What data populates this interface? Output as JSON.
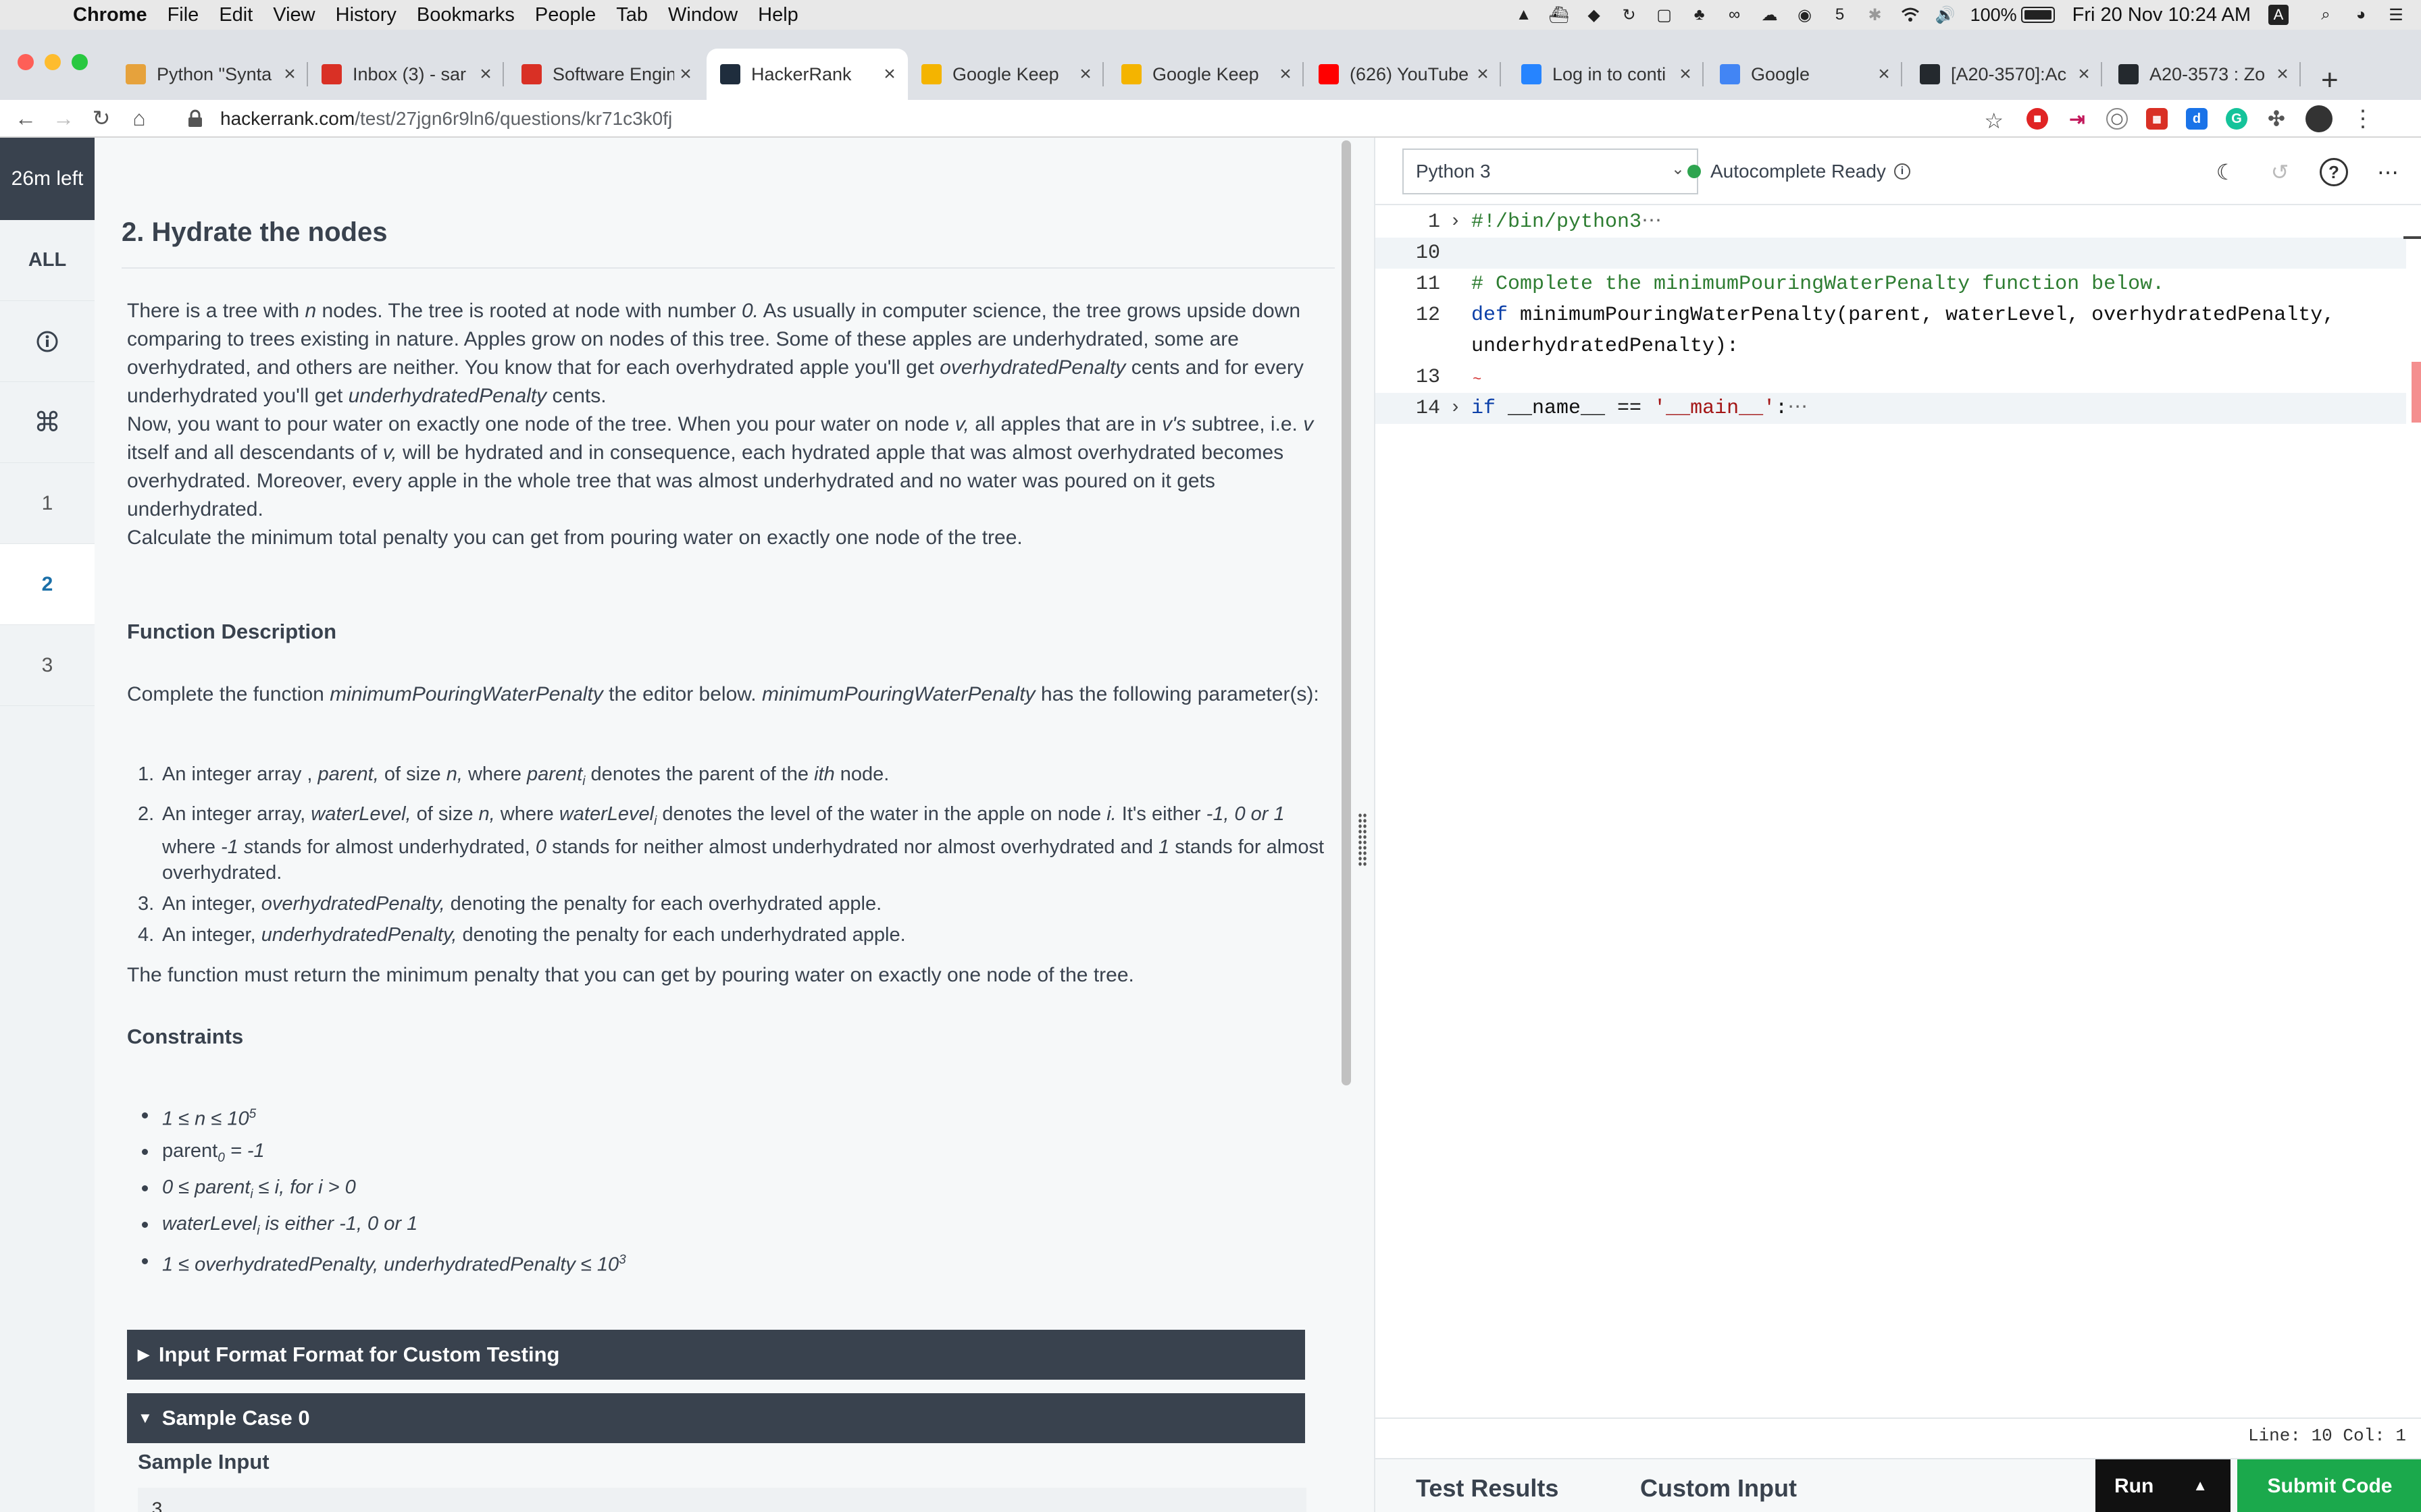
{
  "menubar": {
    "items": [
      "Chrome",
      "File",
      "Edit",
      "View",
      "History",
      "Bookmarks",
      "People",
      "Tab",
      "Window",
      "Help"
    ],
    "battery": "100%",
    "clock": "Fri 20 Nov  10:24 AM",
    "keyboard": "A"
  },
  "tabs": [
    {
      "title": "Python \"Synta",
      "icon": "python-doc-icon",
      "color": "#e6a23c"
    },
    {
      "title": "Inbox (3) - sar",
      "icon": "gmail-icon",
      "color": "#d93025"
    },
    {
      "title": "Software Engin",
      "icon": "gmail-icon",
      "color": "#d93025"
    },
    {
      "title": "HackerRank",
      "icon": "hackerrank-icon",
      "color": "#1f2d3d"
    },
    {
      "title": "Google Keep",
      "icon": "keep-icon",
      "color": "#f4b400"
    },
    {
      "title": "Google Keep",
      "icon": "keep-icon",
      "color": "#f4b400"
    },
    {
      "title": "(626) YouTube",
      "icon": "youtube-icon",
      "color": "#ff0000"
    },
    {
      "title": "Log in to conti",
      "icon": "atlassian-icon",
      "color": "#2684ff"
    },
    {
      "title": "Google",
      "icon": "google-icon",
      "color": "#4285f4"
    },
    {
      "title": "[A20-3570]:Ac",
      "icon": "github-icon",
      "color": "#24292e"
    },
    {
      "title": "A20-3573 : Zo",
      "icon": "github-icon",
      "color": "#24292e"
    }
  ],
  "omnibox": {
    "host": "hackerrank.com",
    "path": "/test/27jgn6r9ln6/questions/kr71c3k0fj"
  },
  "rail": {
    "timer": "26m left",
    "all": "ALL",
    "questions": [
      "1",
      "2",
      "3"
    ]
  },
  "problem": {
    "title": "2. Hydrate the nodes",
    "p1": [
      "There is a tree with ",
      "n",
      " nodes. The tree is rooted at node with number ",
      "0.",
      " As usually in computer science, the tree grows upside down comparing to trees existing in nature. Apples grow on nodes of this tree. Some of these apples are underhydrated, some are overhydrated, and others are neither. You know that for each overhydrated apple you'll get ",
      "overhydratedPenalty",
      " cents and for every underhydrated you'll get ",
      "underhydratedPenalty",
      " cents."
    ],
    "p2": [
      "Now, you want to pour water on exactly one node of the tree. When you pour water on node ",
      "v,",
      " all apples that are in ",
      "v's",
      " subtree, i.e. ",
      "v",
      " itself and all descendants of ",
      "v,",
      " will be hydrated and in consequence, each hydrated apple that was almost overhydrated becomes overhydrated. Moreover, every apple in the whole tree that was almost underhydrated and no water was poured on it gets underhydrated."
    ],
    "p3": "Calculate the minimum total penalty you can get from pouring water on exactly one node of the tree.",
    "fd_heading": "Function Description",
    "fd_text": [
      "Complete the function ",
      "minimumPouringWaterPenalty",
      " the editor below. ",
      "minimumPouringWaterPenalty",
      " has the following parameter(s):"
    ],
    "params": [
      [
        "An integer array , ",
        "parent,",
        " of size ",
        "n,",
        " where ",
        "parent",
        "i",
        " denotes the parent of the ",
        "ith",
        " node."
      ],
      [
        "An integer array, ",
        "waterLevel,",
        " of size ",
        "n,",
        " where ",
        "waterLevel",
        "i",
        " denotes the level of the water in the apple on node ",
        "i.",
        " It's either ",
        "-1, 0 or 1",
        " where ",
        "-1 s",
        "tands for almost underhydrated, ",
        "0",
        " stands for neither almost underhydrated nor almost overhydrated and ",
        "1",
        " stands for almost overhydrated."
      ],
      [
        "An integer, ",
        "overhydratedPenalty,",
        " denoting the penalty for each overhydrated apple."
      ],
      [
        "An integer,  ",
        "underhydratedPenalty,",
        " denoting the penalty for each underhydrated apple."
      ]
    ],
    "return_text": "The function must return the minimum penalty that you can get by pouring water on exactly one node of the tree.",
    "constraints_heading": "Constraints",
    "constraints": [
      [
        "1 ≤ n ≤ 10",
        "5",
        ""
      ],
      [
        "parent",
        "0",
        " = -1"
      ],
      [
        "0 ≤ parent",
        "i",
        " ≤ i, for i > 0"
      ],
      [
        "waterLevel",
        "i",
        " is either -1, 0 or 1"
      ],
      [
        "1 ≤ overhydratedPenalty, underhydratedPenalty ≤ 10",
        "3",
        ""
      ]
    ],
    "accordion_input": "Input Format Format for Custom Testing",
    "accordion_sample": "Sample Case 0",
    "sample_input_label": "Sample Input",
    "sample_input_first": "3"
  },
  "editor": {
    "language": "Python 3",
    "autocomplete": "Autocomplete Ready",
    "lines": [
      {
        "n": "1",
        "fold": true,
        "tokens": [
          {
            "t": "#!/bin/python3",
            "c": "c-com"
          },
          {
            "t": "⋯",
            "c": "c-dots"
          }
        ]
      },
      {
        "n": "10",
        "hl": true,
        "tokens": []
      },
      {
        "n": "11",
        "tokens": [
          {
            "t": "# Complete the minimumPouringWaterPenalty function below.",
            "c": "c-com"
          }
        ]
      },
      {
        "n": "12",
        "tokens": [
          {
            "t": "def",
            "c": "c-kw"
          },
          {
            "t": " minimumPouringWaterPenalty(parent, waterLevel, overhydratedPenalty,",
            "c": ""
          }
        ]
      },
      {
        "n": "",
        "tokens": [
          {
            "t": "underhydratedPenalty):",
            "c": ""
          }
        ]
      },
      {
        "n": "13",
        "squiggle": true,
        "tokens": []
      },
      {
        "n": "14",
        "fold": true,
        "hl": true,
        "tokens": [
          {
            "t": "if",
            "c": "c-kw"
          },
          {
            "t": " __name__ == ",
            "c": ""
          },
          {
            "t": "'__main__'",
            "c": "c-str"
          },
          {
            "t": ":",
            "c": ""
          },
          {
            "t": "⋯",
            "c": "c-dots"
          }
        ]
      }
    ],
    "status": "Line: 10 Col: 1",
    "bottom_tabs": [
      "Test Results",
      "Custom Input"
    ],
    "run": "Run",
    "submit": "Submit Code"
  }
}
